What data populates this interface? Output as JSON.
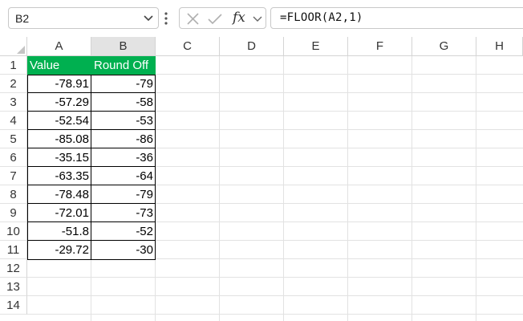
{
  "formula_bar": {
    "name_box": "B2",
    "formula": "=FLOOR(A2,1)",
    "fx_label": "fx"
  },
  "columns": [
    "A",
    "B",
    "C",
    "D",
    "E",
    "F",
    "G",
    "H"
  ],
  "rows": [
    "1",
    "2",
    "3",
    "4",
    "5",
    "6",
    "7",
    "8",
    "9",
    "10",
    "11",
    "12",
    "13",
    "14"
  ],
  "table": {
    "headers": [
      "Value",
      "Round Off"
    ],
    "header_color": "#00b050",
    "values": [
      "-78.91",
      "-57.29",
      "-52.54",
      "-85.08",
      "-35.15",
      "-63.35",
      "-78.48",
      "-72.01",
      "-51.8",
      "-29.72"
    ],
    "rounded": [
      "-79",
      "-58",
      "-53",
      "-86",
      "-36",
      "-64",
      "-79",
      "-73",
      "-52",
      "-30"
    ]
  }
}
